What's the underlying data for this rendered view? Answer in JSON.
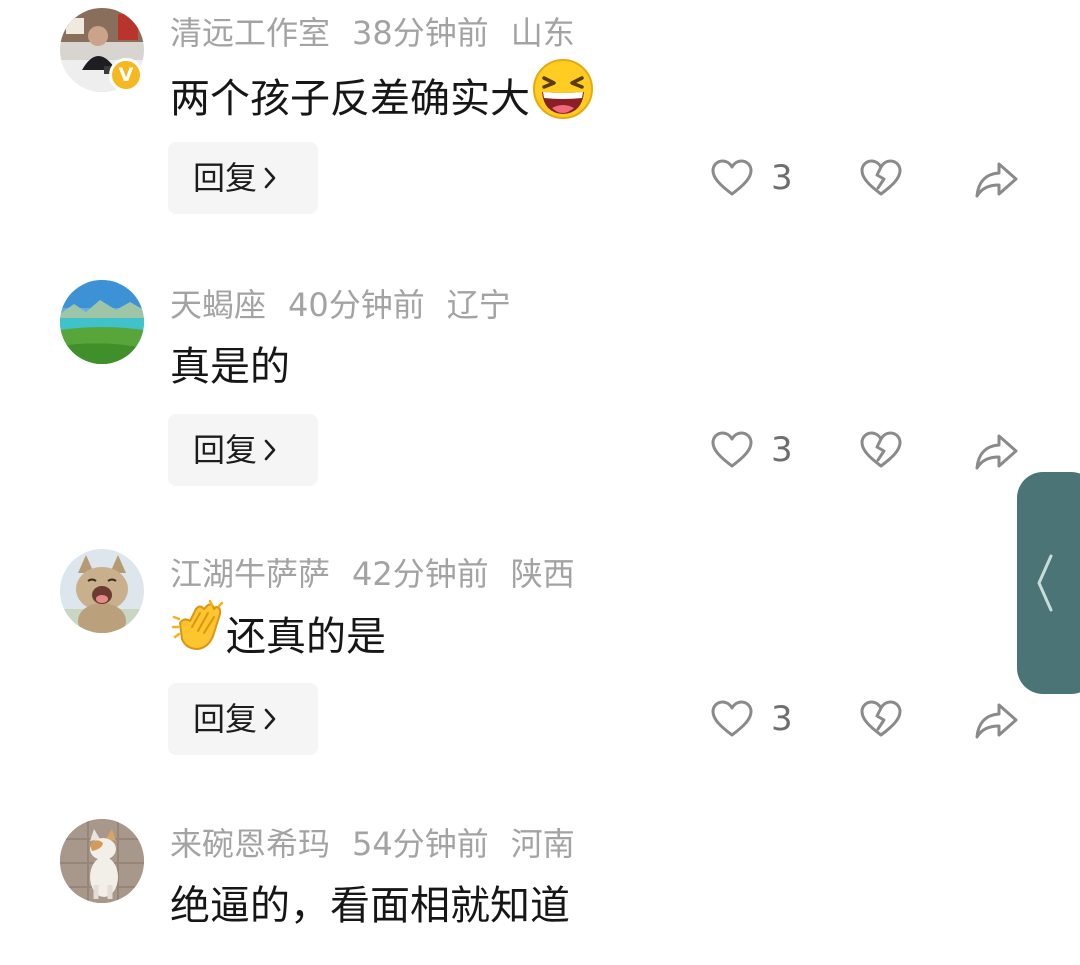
{
  "comments": [
    {
      "username": "清远工作室",
      "time": "38分钟前",
      "location": "山东",
      "text": "两个孩子反差确实大",
      "emoji": "grinning-squinting-face",
      "verified_badge": "V",
      "reply_label": "回复",
      "like_count": "3",
      "avatar": "man-at-desk"
    },
    {
      "username": "天蝎座",
      "time": "40分钟前",
      "location": "辽宁",
      "text": "真是的",
      "reply_label": "回复",
      "like_count": "3",
      "avatar": "landscape-lake"
    },
    {
      "username": "江湖牛萨萨",
      "time": "42分钟前",
      "location": "陕西",
      "text": "还真的是",
      "emoji": "clapping-hands",
      "reply_label": "回复",
      "like_count": "3",
      "avatar": "laughing-cat"
    },
    {
      "username": "来碗恩希玛",
      "time": "54分钟前",
      "location": "河南",
      "text": "绝逼的，看面相就知道",
      "avatar": "calico-cat"
    }
  ],
  "colors": {
    "meta": "#a3a3a3",
    "text": "#161616",
    "reply_bg": "#f5f5f5",
    "icon": "#8a8a8a",
    "side_tab": "#4b7476",
    "badge": "#f5b81e"
  }
}
